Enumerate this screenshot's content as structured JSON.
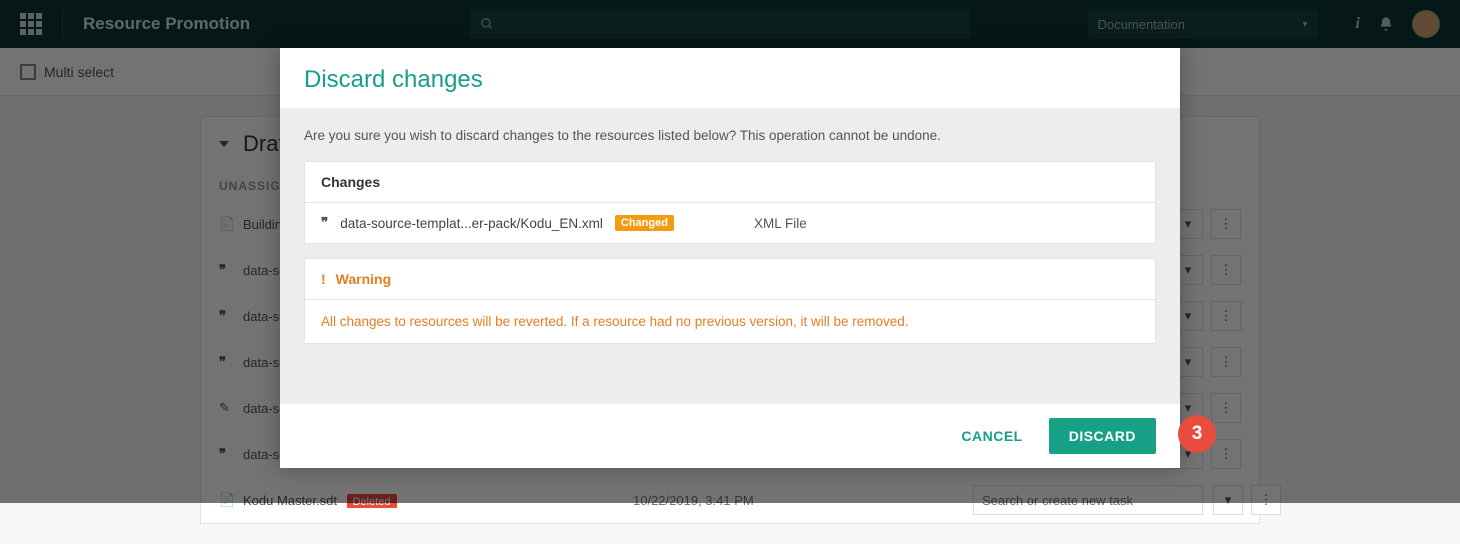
{
  "topbar": {
    "title": "Resource Promotion",
    "doc_select": "Documentation"
  },
  "secbar": {
    "multi_select": "Multi select"
  },
  "bg": {
    "panel_title": "Draf",
    "section": "UNASSIGN",
    "rows": [
      {
        "name": "Building"
      },
      {
        "name": "data-so"
      },
      {
        "name": "data-so"
      },
      {
        "name": "data-so"
      },
      {
        "name": "data-so"
      },
      {
        "name": "data-so"
      },
      {
        "name": "Kodu Master.sdt",
        "deleted": "Deleted",
        "date": "10/22/2019, 3:41 PM",
        "search_ph": "Search or create new task"
      }
    ]
  },
  "modal": {
    "title": "Discard changes",
    "prompt": "Are you sure you wish to discard changes to the resources listed below? This operation cannot be undone.",
    "changes_label": "Changes",
    "item_name": "data-source-templat...er-pack/Kodu_EN.xml",
    "item_badge": "Changed",
    "item_type": "XML File",
    "warning_label": "Warning",
    "warning_text": "All changes to resources will be reverted. If a resource had no previous version, it will be removed.",
    "cancel": "CANCEL",
    "discard": "DISCARD"
  },
  "callout": "3"
}
